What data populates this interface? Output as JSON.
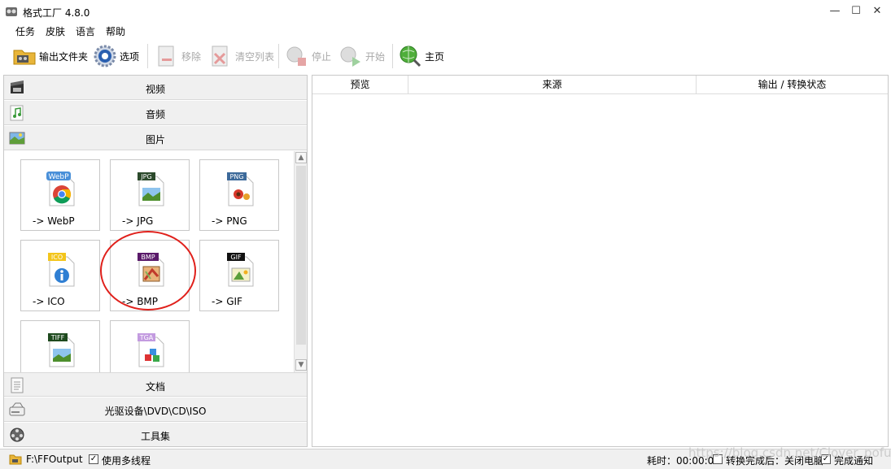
{
  "window": {
    "title": "格式工厂 4.8.0",
    "controls": {
      "minimize": "—",
      "maximize": "☐",
      "close": "✕"
    }
  },
  "menu": [
    "任务",
    "皮肤",
    "语言",
    "帮助"
  ],
  "toolbar": {
    "output_folder": "输出文件夹",
    "options": "选项",
    "remove": "移除",
    "clear_list": "清空列表",
    "stop": "停止",
    "start": "开始",
    "home": "主页"
  },
  "categories": {
    "video": "视频",
    "audio": "音频",
    "image": "图片",
    "document": "文档",
    "disc": "光驱设备\\DVD\\CD\\ISO",
    "tools": "工具集"
  },
  "image_formats": [
    {
      "badge": "WebP",
      "label": "-> WebP"
    },
    {
      "badge": "JPG",
      "label": "-> JPG"
    },
    {
      "badge": "PNG",
      "label": "-> PNG"
    },
    {
      "badge": "ICO",
      "label": "-> ICO"
    },
    {
      "badge": "BMP",
      "label": "-> BMP"
    },
    {
      "badge": "GIF",
      "label": "-> GIF"
    },
    {
      "badge": "TIFF",
      "label": ""
    },
    {
      "badge": "TGA",
      "label": ""
    }
  ],
  "task_table": {
    "columns": [
      "预览",
      "来源",
      "输出 / 转换状态"
    ]
  },
  "statusbar": {
    "output_path": "F:\\FFOutput",
    "multithread": "使用多线程",
    "elapsed": "耗时：00:00:00",
    "after_convert": "转换完成后：关闭电脑",
    "notify": "完成通知"
  },
  "watermark": "https://blog.csdn.net/Clover_pofu",
  "colors": {
    "highlight_circle": "#e0201b",
    "panel_bg": "#f0f0f0"
  }
}
